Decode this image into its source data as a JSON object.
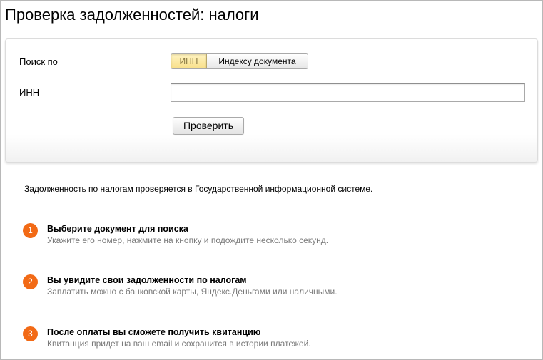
{
  "page": {
    "title": "Проверка задолженностей: налоги"
  },
  "search": {
    "search_by_label": "Поиск по",
    "options": [
      {
        "label": "ИНН",
        "selected": true
      },
      {
        "label": "Индексу документа",
        "selected": false
      }
    ],
    "inn_label": "ИНН",
    "inn_value": "",
    "inn_placeholder": "",
    "submit_label": "Проверить"
  },
  "info": {
    "intro": "Задолженность по налогам проверяется в Государственной информационной системе.",
    "steps": [
      {
        "number": "1",
        "title": "Выберите документ для поиска",
        "description": "Укажите его номер, нажмите на кнопку и подождите несколько секунд."
      },
      {
        "number": "2",
        "title": "Вы увидите свои задолженности по налогам",
        "description": "Заплатить можно с банковской карты, Яндекс.Деньгами или наличными."
      },
      {
        "number": "3",
        "title": "После оплаты вы сможете получить квитанцию",
        "description": "Квитанция придет на ваш email и сохранится в истории платежей."
      }
    ]
  },
  "colors": {
    "accent": "#f26a16",
    "selected_toggle": "#f8e08a",
    "muted_text": "#7a7a7a"
  }
}
